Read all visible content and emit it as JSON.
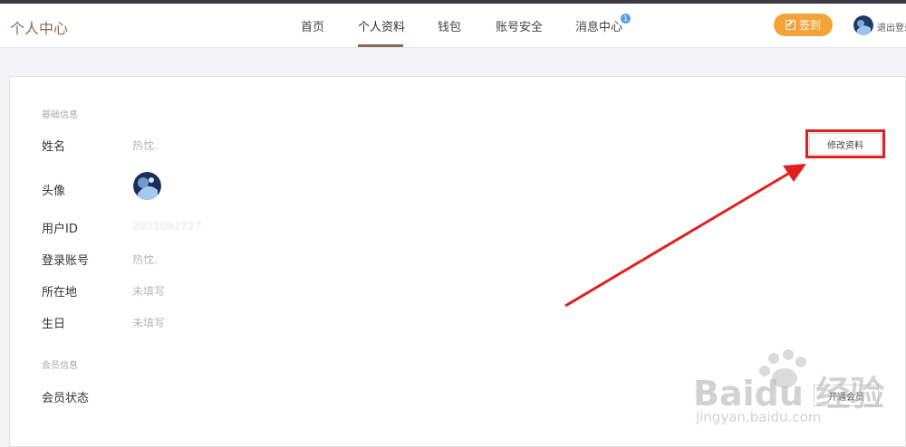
{
  "header": {
    "site_title": "个人中心",
    "nav": [
      "首页",
      "个人资料",
      "钱包",
      "账号安全",
      "消息中心"
    ],
    "active_nav": "个人资料",
    "notification_count": "1",
    "signin_label": "签到",
    "logout_label": "退出登录"
  },
  "profile": {
    "basic_section_title": "基础信息",
    "name_label": "姓名",
    "name_value": "热忱.",
    "avatar_label": "头像",
    "user_id_label": "用户ID",
    "user_id_value": "2031092727",
    "login_account_label": "登录账号",
    "login_account_value": "热忱.",
    "location_label": "所在地",
    "location_value": "未填写",
    "birthday_label": "生日",
    "birthday_value": "未填写",
    "edit_button": "修改资料",
    "member_section_title": "会员信息",
    "member_status_label": "会员状态",
    "open_member_button": "开通会员"
  },
  "watermark": {
    "brand": "Baidu 经验",
    "url": "jingyan.baidu.com"
  },
  "colors": {
    "accent": "#8b6b55",
    "signin": "#f3a33a",
    "badge": "#5b9cf2",
    "annotation": "#e02020"
  }
}
